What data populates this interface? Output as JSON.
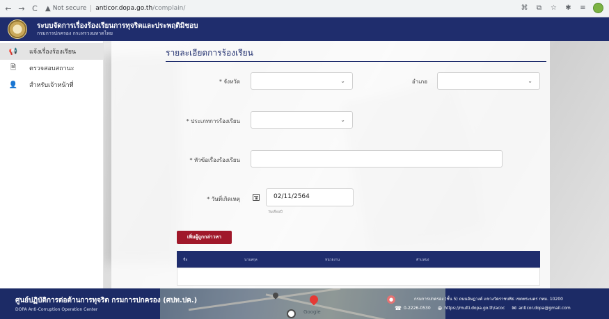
{
  "browser": {
    "back_icon": "←",
    "forward_icon": "→",
    "reload_icon": "C",
    "warning_icon": "▲",
    "not_secure": "Not secure",
    "url_host": "anticor.dopa.go.th",
    "url_path": "/complain/"
  },
  "header": {
    "title": "ระบบจัดการเรื่องร้องเรียนการทุจริตและประพฤติมิชอบ",
    "subtitle": "กรมการปกครอง กระทรวงมหาดไทย"
  },
  "sidebar": {
    "items": [
      {
        "label": "แจ้งเรื่องร้องเรียน",
        "icon": "megaphone-icon",
        "glyph": "📢",
        "active": true
      },
      {
        "label": "ตรวจสอบสถานะ",
        "icon": "document-icon",
        "glyph": "🗎",
        "active": false
      },
      {
        "label": "สำหรับเจ้าหน้าที่",
        "icon": "staff-icon",
        "glyph": "👤",
        "active": false
      }
    ]
  },
  "form": {
    "section_title": "รายละเอียดการร้องเรียน",
    "province_label": "* จังหวัด",
    "district_label": "อำเภอ",
    "complaint_type_label": "* ประเภทการร้องเรียน",
    "subject_label": "* หัวข้อเรื่องร้องเรียน",
    "date_label": "* วันที่เกิดเหตุ",
    "date_value": "02/11/2564",
    "date_hint": "วันเดือนปี",
    "add_accused_button": "เพิ่มผู้ถูกกล่าวหา",
    "table_headers": [
      "ชื่อ",
      "นามสกุล",
      "หน่วยงาน",
      "ตำแหน่ง"
    ]
  },
  "footer": {
    "org_name": "ศูนย์ปฏิบัติการต่อต้านการทุจริต กรมการปกครอง (ศปท.ปค.)",
    "org_name_en": "DOPA Anti-Corruption Operation Center",
    "address": "กรมการปกครอง (ชั้น 5) ถนนอัษฎางค์ แขวงวัดราชบพิธ เขตพระนคร กทม. 10200",
    "phone": "0-2226-0530",
    "website": "https://multi.dopa.go.th/acoc",
    "email": "anticor.dopa@gmail.com",
    "map_label": "Google"
  },
  "colors": {
    "header_bg": "#1f2d6d",
    "button_bg": "#a0182a",
    "footer_bg": "#1c2b66"
  }
}
